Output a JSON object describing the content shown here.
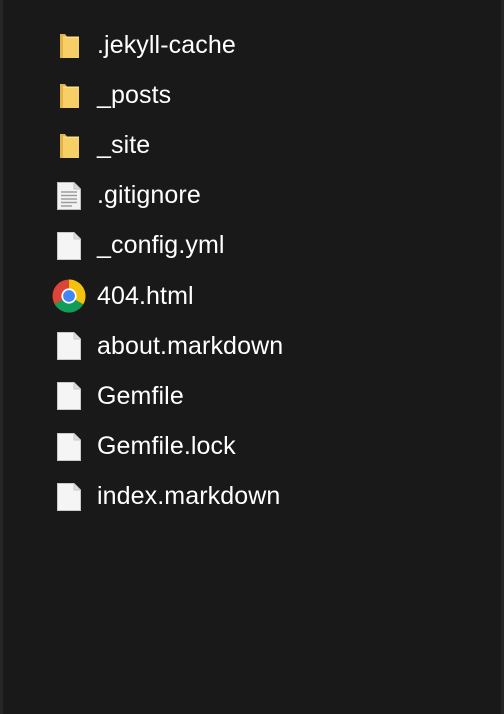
{
  "files": [
    {
      "name": ".jekyll-cache",
      "type": "folder",
      "icon": "folder-icon"
    },
    {
      "name": "_posts",
      "type": "folder",
      "icon": "folder-icon"
    },
    {
      "name": "_site",
      "type": "folder",
      "icon": "folder-icon"
    },
    {
      "name": ".gitignore",
      "type": "text-file",
      "icon": "text-file-icon"
    },
    {
      "name": "_config.yml",
      "type": "file",
      "icon": "file-icon"
    },
    {
      "name": "404.html",
      "type": "html-file",
      "icon": "chrome-icon"
    },
    {
      "name": "about.markdown",
      "type": "file",
      "icon": "file-icon"
    },
    {
      "name": "Gemfile",
      "type": "file",
      "icon": "file-icon"
    },
    {
      "name": "Gemfile.lock",
      "type": "file",
      "icon": "file-icon"
    },
    {
      "name": "index.markdown",
      "type": "file",
      "icon": "file-icon"
    }
  ],
  "colors": {
    "background": "#191919",
    "text": "#ffffff",
    "folder": "#f1c760",
    "file": "#f5f5f5"
  }
}
